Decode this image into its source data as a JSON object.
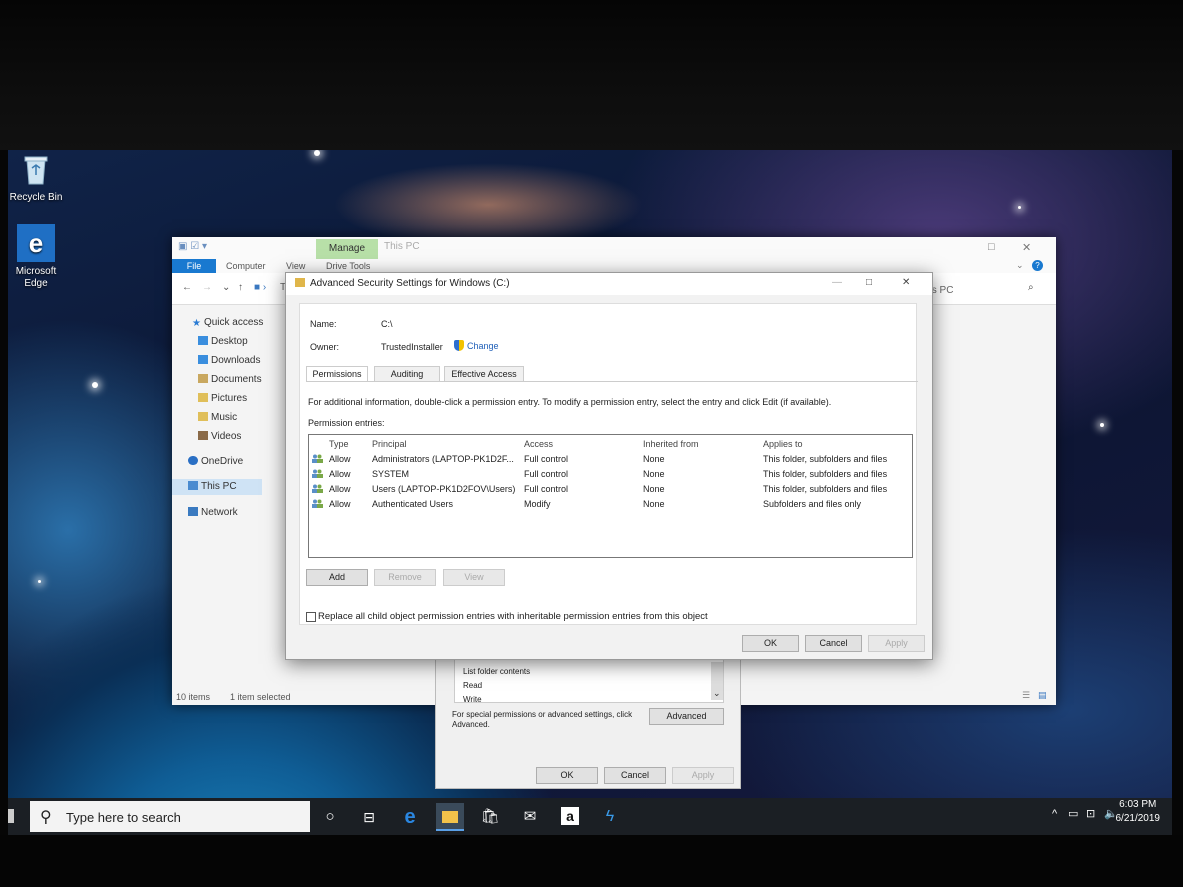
{
  "desktop": {
    "icons": [
      {
        "label": "Recycle Bin"
      },
      {
        "label": "Microsoft Edge"
      }
    ]
  },
  "explorer": {
    "manage_tab": "Manage",
    "title": "This PC",
    "ribbon_tabs": [
      "File",
      "Computer",
      "View",
      "Drive Tools"
    ],
    "address_fragment": "Th",
    "search_fragment": "his PC",
    "nav": [
      {
        "label": "Quick access"
      },
      {
        "label": "Desktop"
      },
      {
        "label": "Downloads"
      },
      {
        "label": "Documents"
      },
      {
        "label": "Pictures"
      },
      {
        "label": "Music"
      },
      {
        "label": "Videos"
      },
      {
        "label": "OneDrive"
      },
      {
        "label": "This PC"
      },
      {
        "label": "Network"
      }
    ],
    "status": {
      "items": "10 items",
      "selected": "1 item selected"
    }
  },
  "permissions_dialog": {
    "list_items": [
      "List folder contents",
      "Read",
      "Write"
    ],
    "special_text": "For special permissions or advanced settings, click Advanced.",
    "advanced_label": "Advanced",
    "ok_label": "OK",
    "cancel_label": "Cancel",
    "apply_label": "Apply"
  },
  "advanced_security": {
    "title": "Advanced Security Settings for Windows (C:)",
    "name_label": "Name:",
    "name_value": "C:\\",
    "owner_label": "Owner:",
    "owner_value": "TrustedInstaller",
    "change_label": "Change",
    "tabs": [
      "Permissions",
      "Auditing",
      "Effective Access"
    ],
    "info_text": "For additional information, double-click a permission entry. To modify a permission entry, select the entry and click Edit (if available).",
    "entries_label": "Permission entries:",
    "columns": [
      "Type",
      "Principal",
      "Access",
      "Inherited from",
      "Applies to"
    ],
    "rows": [
      [
        "Allow",
        "Administrators (LAPTOP-PK1D2F...",
        "Full control",
        "None",
        "This folder, subfolders and files"
      ],
      [
        "Allow",
        "SYSTEM",
        "Full control",
        "None",
        "This folder, subfolders and files"
      ],
      [
        "Allow",
        "Users (LAPTOP-PK1D2FOV\\Users)",
        "Full control",
        "None",
        "This folder, subfolders and files"
      ],
      [
        "Allow",
        "Authenticated Users",
        "Modify",
        "None",
        "Subfolders and files only"
      ]
    ],
    "add_label": "Add",
    "remove_label": "Remove",
    "view_label": "View",
    "replace_label": "Replace all child object permission entries with inheritable permission entries from this object",
    "ok_label": "OK",
    "cancel_label": "Cancel",
    "apply_label": "Apply"
  },
  "taskbar": {
    "search_placeholder": "Type here to search",
    "time": "6:03 PM",
    "date": "6/21/2019"
  }
}
